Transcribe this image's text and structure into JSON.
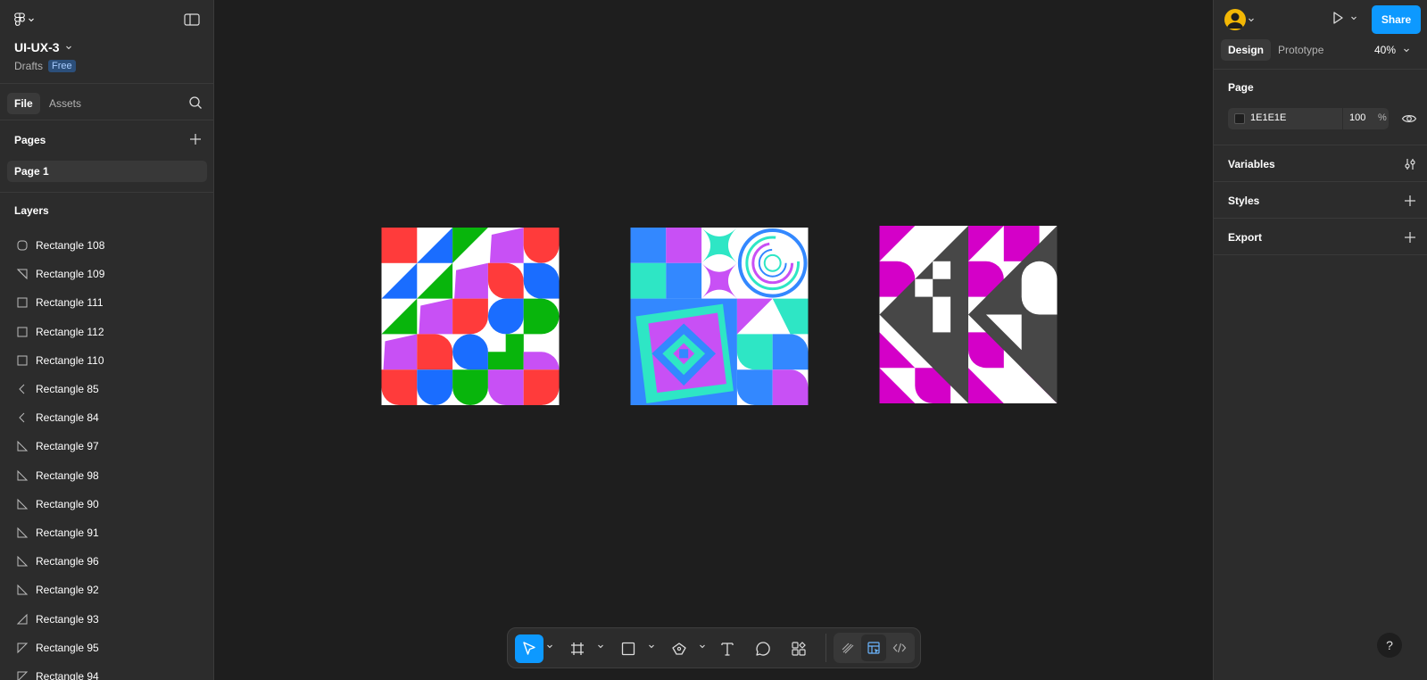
{
  "file": {
    "name": "UI-UX-3",
    "location": "Drafts",
    "plan": "Free"
  },
  "left_tabs": {
    "file": "File",
    "assets": "Assets"
  },
  "pages": {
    "title": "Pages",
    "items": [
      "Page 1"
    ]
  },
  "layers": {
    "title": "Layers",
    "items": [
      {
        "name": "Rectangle 108",
        "icon": "rounded-rect-icon"
      },
      {
        "name": "Rectangle 109",
        "icon": "triangle-corner-icon"
      },
      {
        "name": "Rectangle 111",
        "icon": "rectangle-icon"
      },
      {
        "name": "Rectangle 112",
        "icon": "rectangle-icon"
      },
      {
        "name": "Rectangle 110",
        "icon": "rectangle-icon"
      },
      {
        "name": "Rectangle 85",
        "icon": "triangle-left-icon"
      },
      {
        "name": "Rectangle 84",
        "icon": "triangle-left-icon"
      },
      {
        "name": "Rectangle 97",
        "icon": "right-triangle-icon"
      },
      {
        "name": "Rectangle 98",
        "icon": "right-triangle-icon"
      },
      {
        "name": "Rectangle 90",
        "icon": "right-triangle-icon"
      },
      {
        "name": "Rectangle 91",
        "icon": "right-triangle-icon"
      },
      {
        "name": "Rectangle 96",
        "icon": "right-triangle-icon"
      },
      {
        "name": "Rectangle 92",
        "icon": "right-triangle-icon"
      },
      {
        "name": "Rectangle 93",
        "icon": "right-triangle-flipped-icon"
      },
      {
        "name": "Rectangle 95",
        "icon": "right-triangle-top-icon"
      },
      {
        "name": "Rectangle 94",
        "icon": "right-triangle-top-icon"
      }
    ]
  },
  "right_panel": {
    "share": "Share",
    "tabs": {
      "design": "Design",
      "prototype": "Prototype"
    },
    "zoom": "40%",
    "page_section": {
      "title": "Page",
      "color_hex": "1E1E1E",
      "opacity": "100",
      "percent": "%"
    },
    "variables": "Variables",
    "styles": "Styles",
    "export": "Export",
    "help": "?"
  },
  "colors": {
    "accent": "#0d99ff",
    "canvas": "#1e1e1e",
    "panel": "#2c2c2c",
    "art_red": "#ff3b3b",
    "art_blue": "#1a6dff",
    "art_green": "#08b50c",
    "art_purple": "#c850f5",
    "art_teal": "#2ee6c5",
    "art_magenta": "#d400c8",
    "art_gray": "#474747"
  },
  "toolbar": {
    "tools": [
      "move-icon",
      "frame-icon",
      "rectangle-icon",
      "pen-icon",
      "text-icon",
      "comment-icon",
      "actions-icon"
    ],
    "mode_tools": [
      "draw-mode-icon",
      "design-mode-icon",
      "dev-mode-icon"
    ]
  }
}
